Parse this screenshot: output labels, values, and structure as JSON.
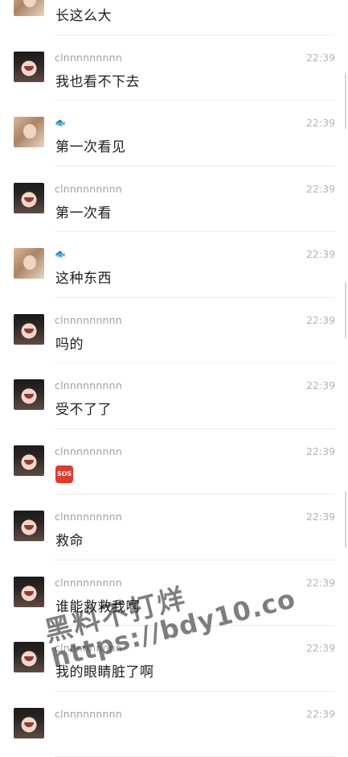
{
  "messages": [
    {
      "avatar": "avatar-b",
      "avatar_icon": "girl-photo-avatar",
      "name": "",
      "time": "",
      "text": "长这么大"
    },
    {
      "avatar": "avatar-a",
      "avatar_icon": "girl-face-avatar",
      "name": "clnnnnnnnnn",
      "time": "22:39",
      "text": "我也看不下去"
    },
    {
      "avatar": "avatar-b",
      "avatar_icon": "fish-icon",
      "name": "🐟",
      "time": "22:39",
      "text": "第一次看见"
    },
    {
      "avatar": "avatar-a",
      "avatar_icon": "girl-face-avatar",
      "name": "clnnnnnnnnn",
      "time": "22:39",
      "text": "第一次看"
    },
    {
      "avatar": "avatar-b",
      "avatar_icon": "fish-icon",
      "name": "🐟",
      "time": "22:39",
      "text": "这种东西"
    },
    {
      "avatar": "avatar-a",
      "avatar_icon": "girl-face-avatar",
      "name": "clnnnnnnnnn",
      "time": "22:39",
      "text": "吗的"
    },
    {
      "avatar": "avatar-a",
      "avatar_icon": "girl-face-avatar",
      "name": "clnnnnnnnnn",
      "time": "22:39",
      "text": "受不了了"
    },
    {
      "avatar": "avatar-a",
      "avatar_icon": "sos-emoji",
      "name": "clnnnnnnnnn",
      "time": "22:39",
      "text": "SOS"
    },
    {
      "avatar": "avatar-a",
      "avatar_icon": "girl-face-avatar",
      "name": "clnnnnnnnnn",
      "time": "22:39",
      "text": "救命"
    },
    {
      "avatar": "avatar-a",
      "avatar_icon": "girl-face-avatar",
      "name": "clnnnnnnnnn",
      "time": "22:39",
      "text": "谁能救救我啊"
    },
    {
      "avatar": "avatar-a",
      "avatar_icon": "girl-face-avatar",
      "name": "clnnnnnnnnn",
      "time": "22:39",
      "text": "我的眼睛脏了啊"
    },
    {
      "avatar": "avatar-a",
      "avatar_icon": "girl-face-avatar",
      "name": "clnnnnnnnnn",
      "time": "22:39",
      "text": ""
    }
  ],
  "watermark": {
    "line1": "黑料不打烊",
    "line2": "https://bdy10.co"
  }
}
